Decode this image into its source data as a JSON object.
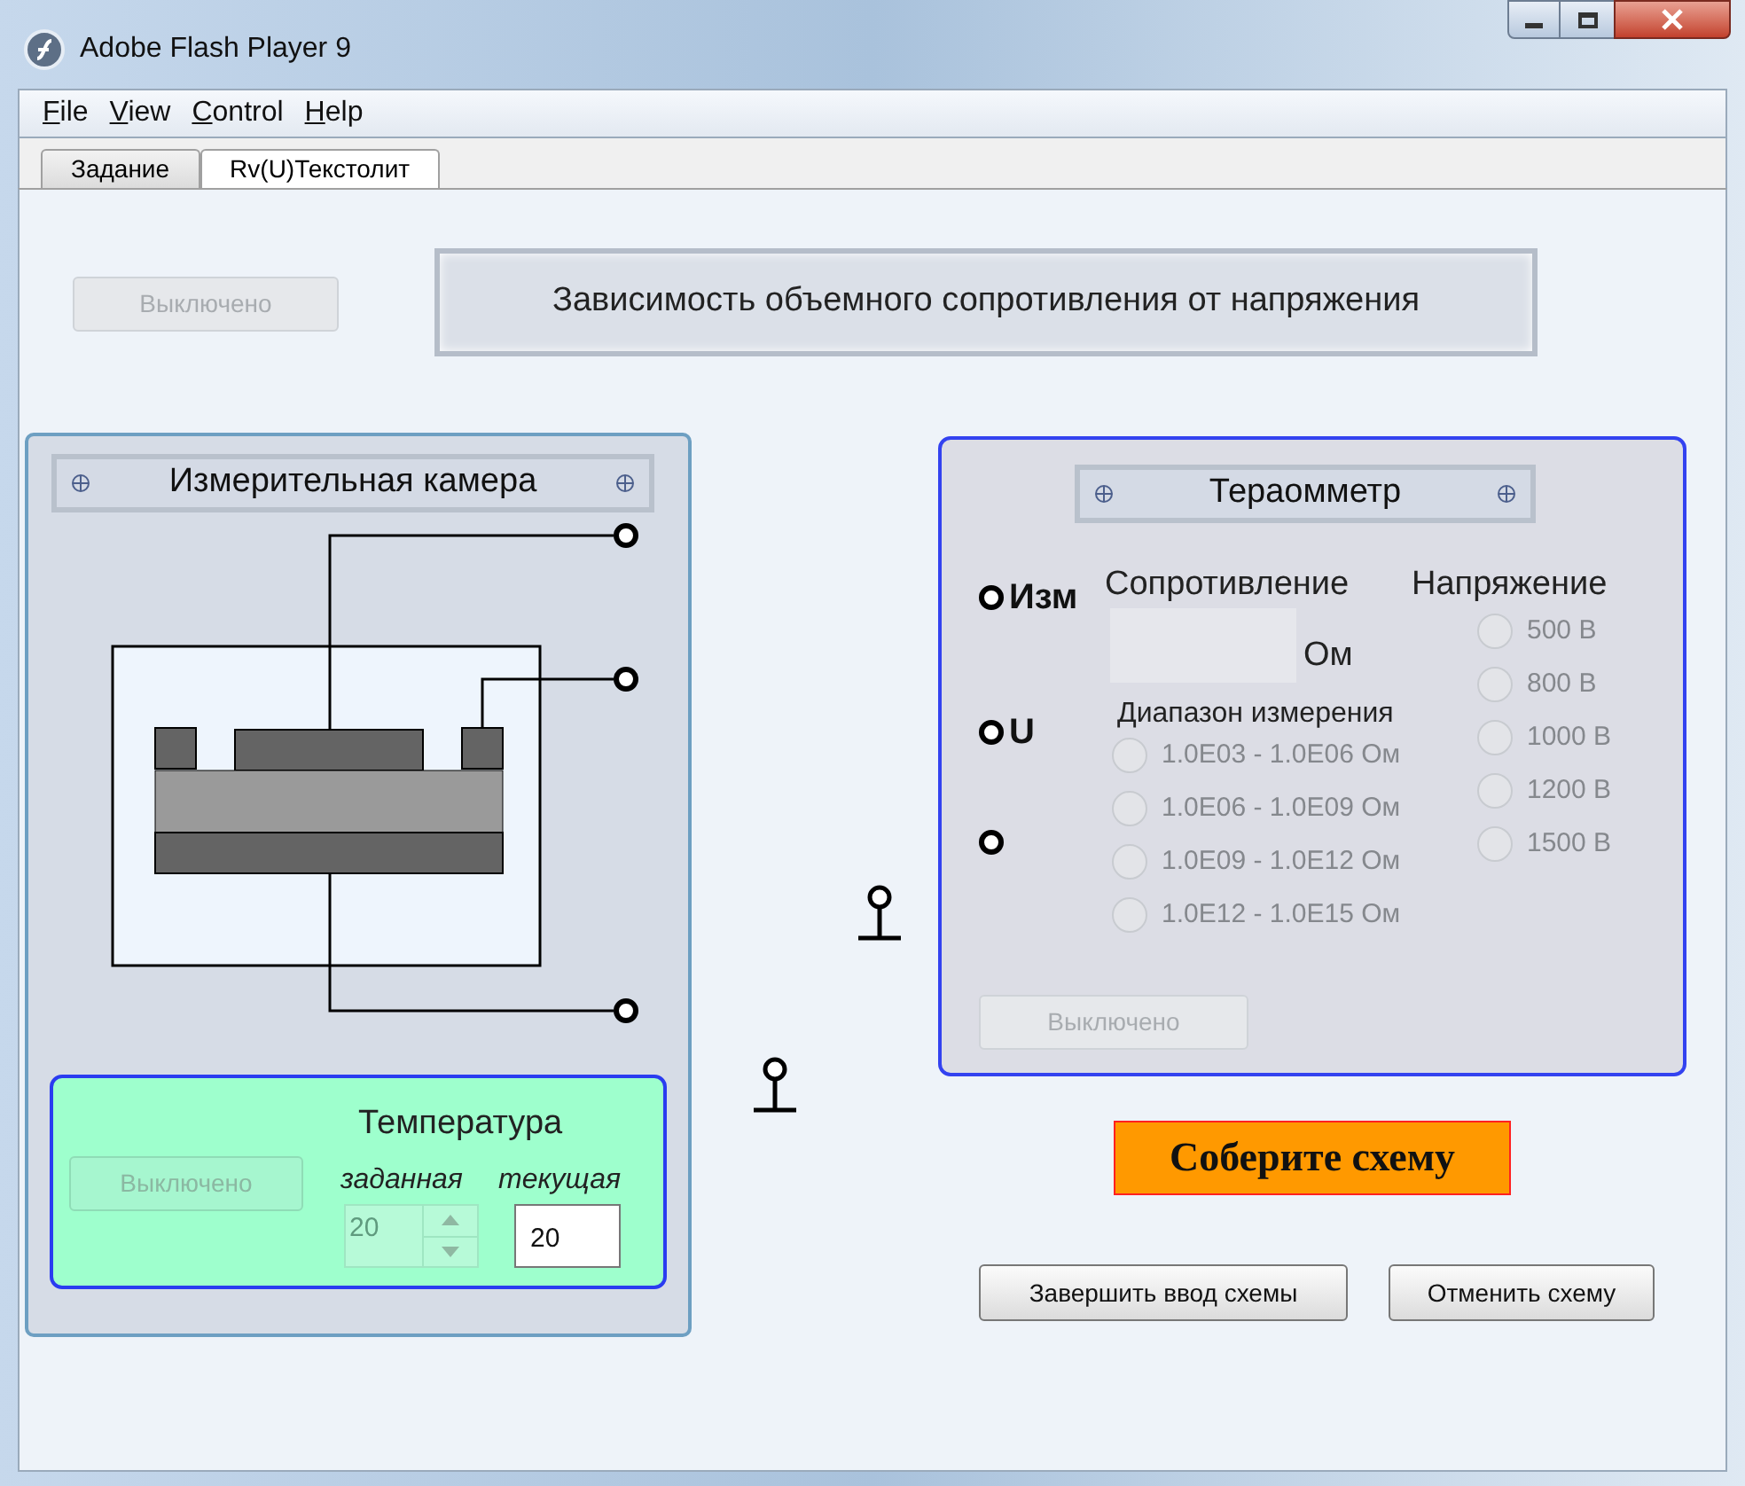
{
  "window": {
    "title": "Adobe Flash Player 9"
  },
  "menu": [
    "File",
    "View",
    "Control",
    "Help"
  ],
  "tabs": [
    {
      "label": "Задание",
      "selected": false
    },
    {
      "label": "Rv(U)Текстолит",
      "selected": true
    }
  ],
  "power_button": {
    "label": "Выключено",
    "disabled": true
  },
  "heading": "Зависимость объемного сопротивления от напряжения",
  "chamber": {
    "title": "Измерительная камера",
    "temperature": {
      "title": "Температура",
      "button": {
        "label": "Выключено",
        "disabled": true
      },
      "set_label": "заданная",
      "set_value": "20",
      "set_disabled": true,
      "current_label": "текущая",
      "current_value": "20"
    }
  },
  "teraohmmeter": {
    "title": "Тераомметр",
    "terminals": [
      "Изм",
      "U"
    ],
    "resistance_label": "Сопротивление",
    "unit": "Ом",
    "range_label": "Диапазон измерения",
    "ranges": [
      {
        "label": "1.0E03 - 1.0E06 Ом",
        "selected": false,
        "disabled": true
      },
      {
        "label": "1.0E06 - 1.0E09 Ом",
        "selected": false,
        "disabled": true
      },
      {
        "label": "1.0E09 - 1.0E12 Ом",
        "selected": false,
        "disabled": true
      },
      {
        "label": "1.0E12 - 1.0E15 Ом",
        "selected": false,
        "disabled": true
      }
    ],
    "voltage_label": "Напряжение",
    "voltages": [
      {
        "label": "500 В",
        "selected": false,
        "disabled": true
      },
      {
        "label": "800 В",
        "selected": false,
        "disabled": true
      },
      {
        "label": "1000 В",
        "selected": false,
        "disabled": true
      },
      {
        "label": "1200 В",
        "selected": false,
        "disabled": true
      },
      {
        "label": "1500 В",
        "selected": false,
        "disabled": true
      }
    ],
    "button": {
      "label": "Выключено",
      "disabled": true
    }
  },
  "status": "Соберите схему",
  "buttons": [
    "Завершить ввод схемы",
    "Отменить схему"
  ]
}
